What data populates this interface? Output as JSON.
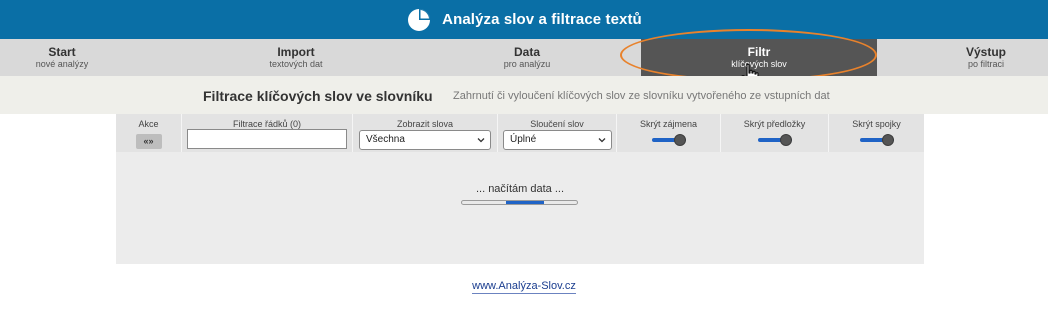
{
  "app": {
    "title": "Analýza slov a filtrace textů",
    "logo_icon": "pie-chart-icon",
    "header_color": "#0a6fa6"
  },
  "nav": {
    "items": [
      {
        "label": "Start",
        "sub": "nové analýzy"
      },
      {
        "label": "Import",
        "sub": "textových dat"
      },
      {
        "label": "Data",
        "sub": "pro analýzu"
      },
      {
        "label": "Filtr",
        "sub": "klíčových slov",
        "active": true
      },
      {
        "label": "Výstup",
        "sub": "po filtraci"
      }
    ],
    "highlight_color": "#e8822c"
  },
  "page": {
    "title": "Filtrace klíčových slov ve slovníku",
    "subtitle": "Zahrnutí či vyloučení klíčových slov ze slovníku vytvořeného ze vstupních dat"
  },
  "filters": {
    "akce": {
      "header": "Akce",
      "button": "«»"
    },
    "row_filter": {
      "header": "Filtrace řádků (0)",
      "value": ""
    },
    "show_words": {
      "header": "Zobrazit slova",
      "selected": "Všechna"
    },
    "merge_words": {
      "header": "Sloučení slov",
      "selected": "Úplné"
    },
    "hide_pronouns": {
      "header": "Skrýt zájmena",
      "on": true
    },
    "hide_prepositions": {
      "header": "Skrýt předložky",
      "on": true
    },
    "hide_conjunctions": {
      "header": "Skrýt spojky",
      "on": true
    }
  },
  "loading": {
    "text": "... načítám data ...",
    "progress_color": "#1f63c6"
  },
  "footer": {
    "link": "www.Analýza-Slov.cz"
  }
}
